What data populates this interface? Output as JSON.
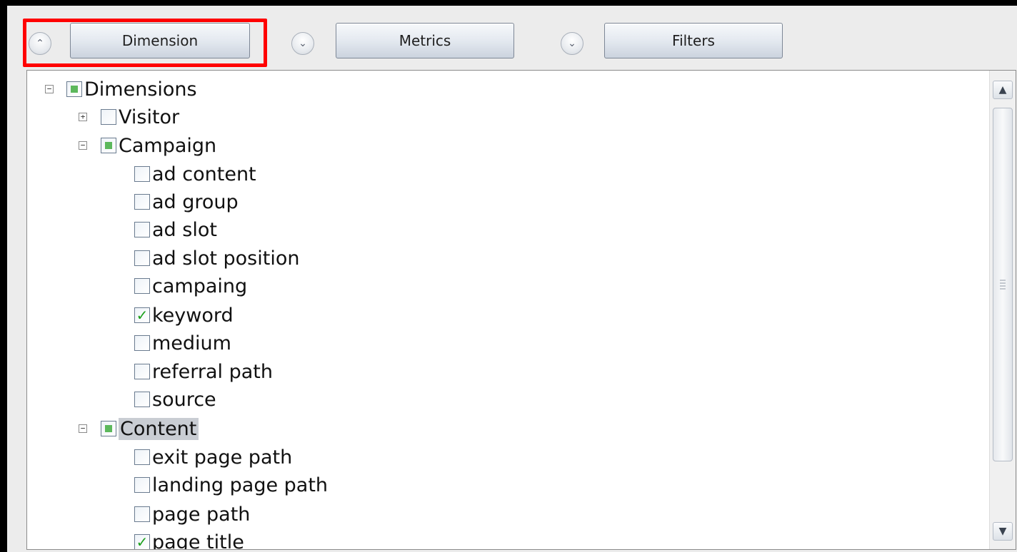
{
  "toolbar": {
    "dimension_label": "Dimension",
    "metrics_label": "Metrics",
    "filters_label": "Filters",
    "collapse_icon": "chevron-up",
    "expand_icon": "chevron-down"
  },
  "tree": {
    "root": {
      "label": "Dimensions",
      "expander": "−",
      "state": "partial"
    },
    "groups": [
      {
        "label": "Visitor",
        "expander": "+",
        "state": "none"
      },
      {
        "label": "Campaign",
        "expander": "−",
        "state": "partial",
        "items": [
          {
            "label": "ad content",
            "checked": false
          },
          {
            "label": "ad group",
            "checked": false
          },
          {
            "label": "ad slot",
            "checked": false
          },
          {
            "label": "ad slot position",
            "checked": false
          },
          {
            "label": "campaing",
            "checked": false
          },
          {
            "label": "keyword",
            "checked": true
          },
          {
            "label": "medium",
            "checked": false
          },
          {
            "label": "referral path",
            "checked": false
          },
          {
            "label": "source",
            "checked": false
          }
        ]
      },
      {
        "label": "Content",
        "expander": "−",
        "state": "partial",
        "selected": true,
        "items": [
          {
            "label": "exit page path",
            "checked": false
          },
          {
            "label": "landing page path",
            "checked": false
          },
          {
            "label": "page path",
            "checked": false
          },
          {
            "label": "page title",
            "checked": true
          }
        ]
      }
    ]
  },
  "colors": {
    "highlight": "#ff0000",
    "check": "#1aa01a",
    "partial": "#5cb85c"
  }
}
